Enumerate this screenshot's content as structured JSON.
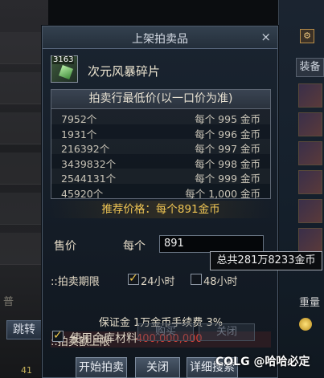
{
  "dialog": {
    "title": "上架拍卖品",
    "close_icon": "×",
    "item": {
      "count": "3163",
      "name": "次元风暴碎片"
    },
    "price_table": {
      "header": "拍卖行最低价(以一口价为准)",
      "rows": [
        {
          "qty": "7952个",
          "per": "每个 995 金币"
        },
        {
          "qty": "1931个",
          "per": "每个 996 金币"
        },
        {
          "qty": "216392个",
          "per": "每个 997 金币"
        },
        {
          "qty": "3439832个",
          "per": "每个 998 金币"
        },
        {
          "qty": "2544131个",
          "per": "每个 999 金币"
        },
        {
          "qty": "45920个",
          "per": "每个 1,000 金币"
        }
      ]
    },
    "recommend": "推荐价格：每个891金币",
    "price_label": "售价",
    "each_label": "每个",
    "price_value": "891",
    "total_tooltip": "总共281万8233金币",
    "period_label": "::拍卖期限",
    "option_24": "24小时",
    "option_48": "48小时",
    "deposit": "保证金 1万金币手续费 3%",
    "limit_label": "::拍卖额上限",
    "limit_value": "400,000,000",
    "ghost_buy": "购买",
    "ghost_close": "关闭",
    "use_vault": "使用金库材料",
    "buttons": {
      "start": "开始拍卖",
      "close": "关闭",
      "detail": "详细搜索"
    }
  },
  "background": {
    "jump_button": "跳转",
    "equip_tab": "装备",
    "weight_text": "重量",
    "left_text": "普",
    "gear_glyph": "⚙",
    "level_tag": "41"
  },
  "watermark": "COLG @哈哈必定",
  "colors": {
    "accent_gold": "#f0c654",
    "limit_red": "#d9433a"
  }
}
